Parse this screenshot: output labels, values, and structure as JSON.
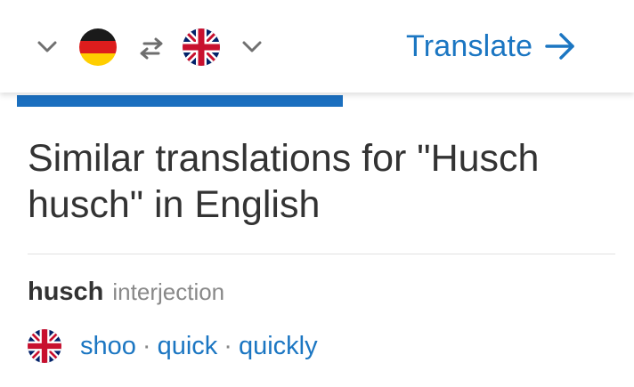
{
  "header": {
    "source_language_flag": "germany-flag-icon",
    "target_language_flag": "united-kingdom-flag-icon",
    "translate_label": "Translate"
  },
  "progress": {
    "fraction": 0.545
  },
  "main": {
    "heading": "Similar translations for \"Husch husch\" in English",
    "entries": [
      {
        "word": "husch",
        "part_of_speech": "interjection",
        "translations": [
          "shoo",
          "quick",
          "quickly"
        ]
      }
    ],
    "separator": "·"
  },
  "colors": {
    "accent": "#1b76c2",
    "progress": "#1b6fbf",
    "text": "#333333",
    "muted": "#888888"
  }
}
